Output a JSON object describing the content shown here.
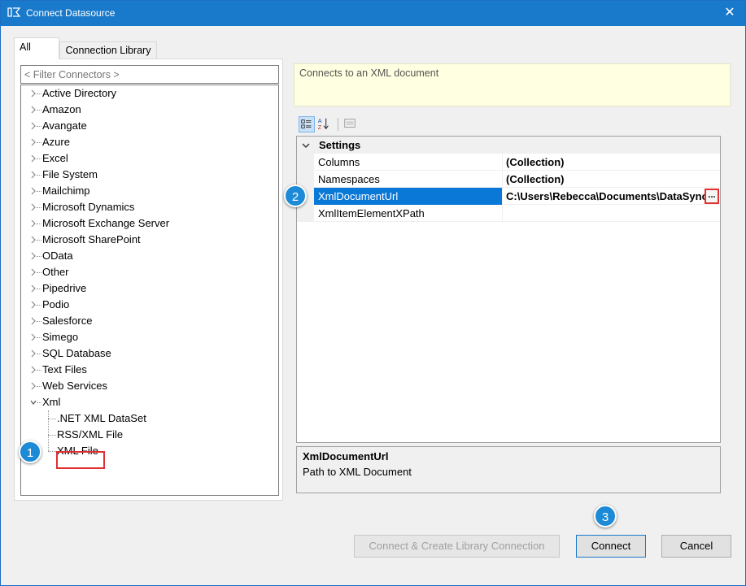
{
  "window": {
    "title": "Connect Datasource",
    "close_glyph": "✕"
  },
  "tabs": [
    {
      "label": "All"
    },
    {
      "label": "Connection Library"
    }
  ],
  "filter": {
    "placeholder": "< Filter Connectors >"
  },
  "tree": {
    "items": [
      {
        "label": "Active Directory"
      },
      {
        "label": "Amazon"
      },
      {
        "label": "Avangate"
      },
      {
        "label": "Azure"
      },
      {
        "label": "Excel"
      },
      {
        "label": "File System"
      },
      {
        "label": "Mailchimp"
      },
      {
        "label": "Microsoft Dynamics"
      },
      {
        "label": "Microsoft Exchange Server"
      },
      {
        "label": "Microsoft SharePoint"
      },
      {
        "label": "OData"
      },
      {
        "label": "Other"
      },
      {
        "label": "Pipedrive"
      },
      {
        "label": "Podio"
      },
      {
        "label": "Salesforce"
      },
      {
        "label": "Simego"
      },
      {
        "label": "SQL Database"
      },
      {
        "label": "Text Files"
      },
      {
        "label": "Web Services"
      },
      {
        "label": "Xml"
      }
    ],
    "xml_children": [
      {
        "label": ".NET XML DataSet"
      },
      {
        "label": "RSS/XML File"
      },
      {
        "label": "XML File"
      }
    ]
  },
  "badges": {
    "one": "1",
    "two": "2",
    "three": "3"
  },
  "description": "Connects to an XML document",
  "property_grid": {
    "category": "Settings",
    "rows": [
      {
        "name": "Columns",
        "value": "(Collection)"
      },
      {
        "name": "Namespaces",
        "value": "(Collection)"
      },
      {
        "name": "XmlDocumentUrl",
        "value": "C:\\Users\\Rebecca\\Documents\\DataSync"
      },
      {
        "name": "XmlItemElementXPath",
        "value": ""
      }
    ],
    "ellipsis": "...",
    "selected_index": 2
  },
  "help": {
    "title": "XmlDocumentUrl",
    "description": "Path to XML Document"
  },
  "buttons": {
    "create": "Connect & Create Library Connection",
    "connect": "Connect",
    "cancel": "Cancel"
  },
  "colors": {
    "titlebar": "#1979ca",
    "selection": "#0a78d7",
    "highlight_border": "#e03030",
    "badge": "#1c8ad6",
    "description_bg": "#ffffe1"
  }
}
